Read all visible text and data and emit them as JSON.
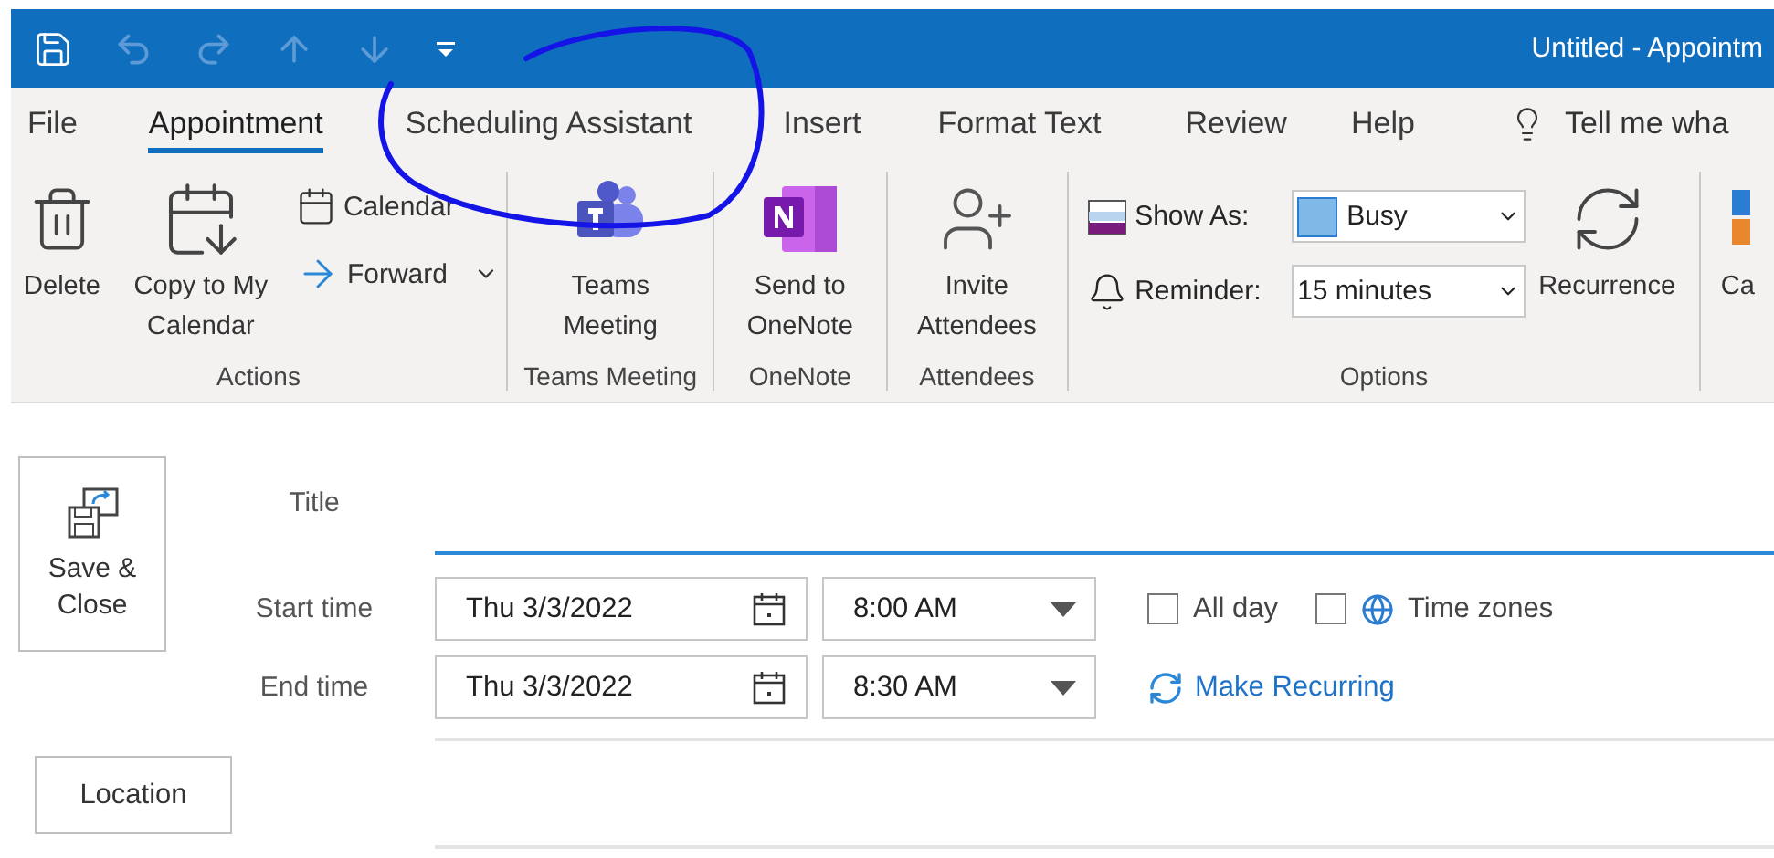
{
  "title_bar": {
    "title": "Untitled  -  Appointm"
  },
  "tabs": [
    {
      "label": "File",
      "selected": false
    },
    {
      "label": "Appointment",
      "selected": true
    },
    {
      "label": "Scheduling Assistant",
      "selected": false
    },
    {
      "label": "Insert",
      "selected": false
    },
    {
      "label": "Format Text",
      "selected": false
    },
    {
      "label": "Review",
      "selected": false
    },
    {
      "label": "Help",
      "selected": false
    }
  ],
  "tell_me": {
    "placeholder": "Tell me wha"
  },
  "ribbon": {
    "groups": [
      {
        "label": "Actions",
        "items": [
          {
            "kind": "large",
            "label": "Delete"
          },
          {
            "kind": "large",
            "label": "Copy to My Calendar"
          },
          {
            "kind": "stack",
            "buttons": [
              {
                "label": "Calendar",
                "dropdown": false
              },
              {
                "label": "Forward",
                "dropdown": true
              }
            ]
          }
        ]
      },
      {
        "label": "Teams Meeting",
        "items": [
          {
            "kind": "large",
            "label": "Teams Meeting"
          }
        ]
      },
      {
        "label": "OneNote",
        "items": [
          {
            "kind": "large",
            "label": "Send to OneNote"
          }
        ]
      },
      {
        "label": "Attendees",
        "items": [
          {
            "kind": "large",
            "label": "Invite Attendees"
          }
        ]
      },
      {
        "label": "Options",
        "items": [
          {
            "kind": "fields",
            "rows": [
              {
                "label": "Show As:",
                "value": "Busy",
                "color": "#7fb9e8"
              },
              {
                "label": "Reminder:",
                "value": "15 minutes"
              }
            ]
          },
          {
            "kind": "large",
            "label": "Recurrence"
          }
        ]
      },
      {
        "items": [
          {
            "kind": "large",
            "label": "Ca"
          }
        ]
      }
    ]
  },
  "form": {
    "save_close": "Save & Close",
    "title_label": "Title",
    "start": {
      "label": "Start time",
      "date": "Thu 3/3/2022",
      "time": "8:00 AM"
    },
    "end": {
      "label": "End time",
      "date": "Thu 3/3/2022",
      "time": "8:30 AM"
    },
    "all_day": {
      "label": "All day",
      "checked": false
    },
    "time_zones": {
      "label": "Time zones",
      "checked": false
    },
    "make_recurring": "Make Recurring",
    "location": "Location"
  }
}
